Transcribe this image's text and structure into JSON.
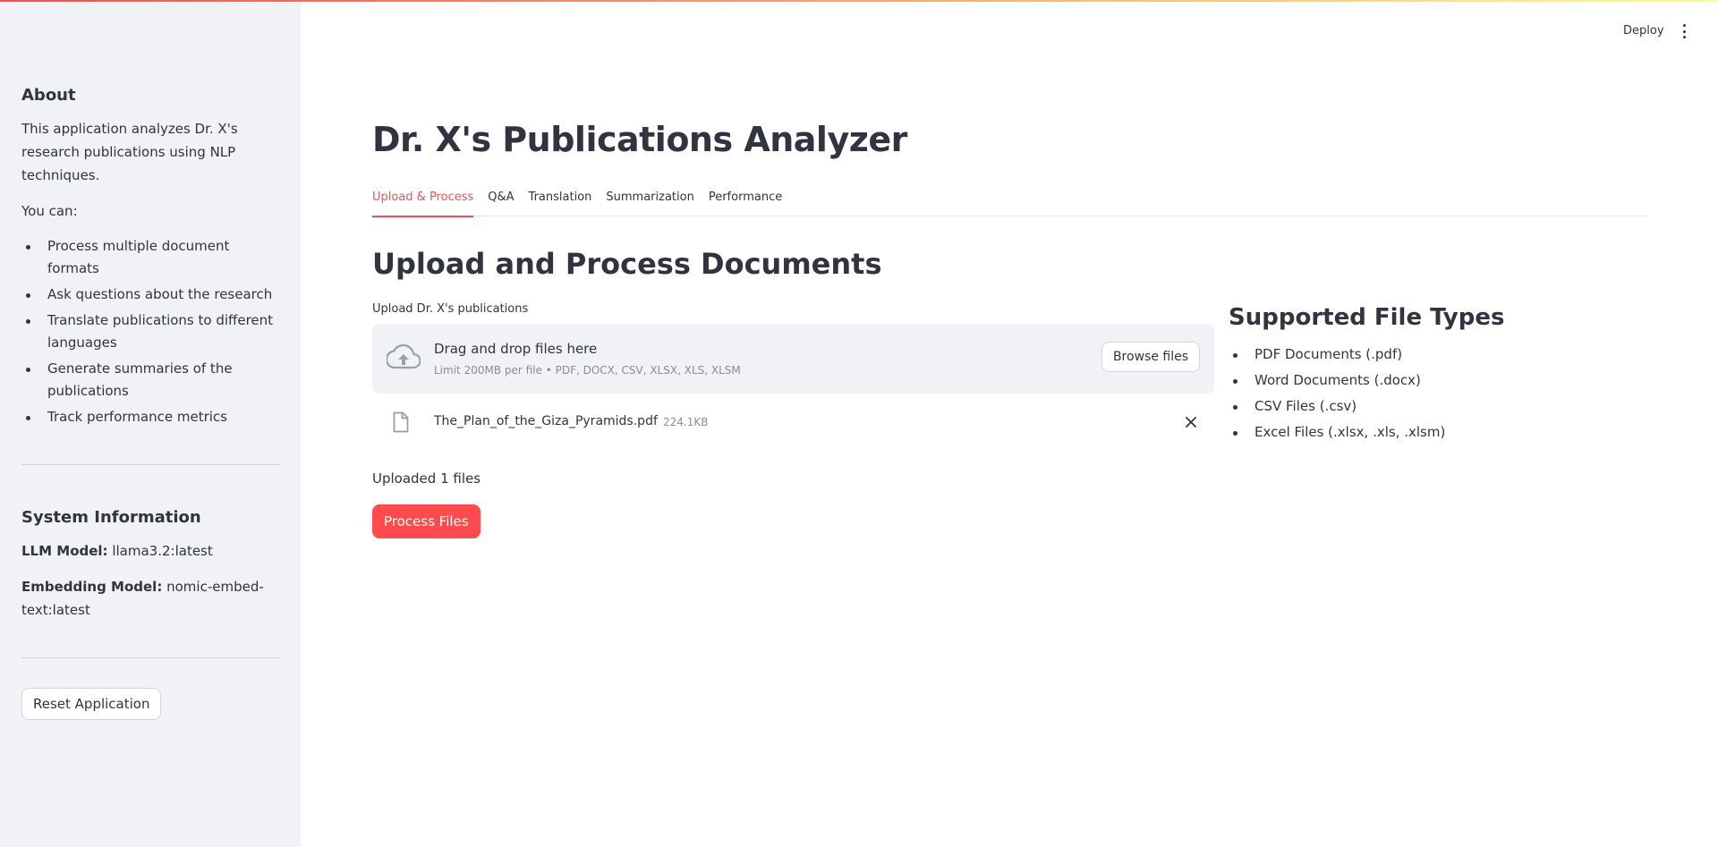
{
  "header": {
    "deploy_label": "Deploy"
  },
  "sidebar": {
    "about_heading": "About",
    "about_text": "This application analyzes Dr. X's research publications using NLP techniques.",
    "you_can": "You can:",
    "items": [
      "Process multiple document formats",
      "Ask questions about the research",
      "Translate publications to different languages",
      "Generate summaries of the publications",
      "Track performance metrics"
    ],
    "system_heading": "System Information",
    "llm_label": "LLM Model:",
    "llm_value": "llama3.2:latest",
    "embedding_label": "Embedding Model:",
    "embedding_value": "nomic-embed-text:latest",
    "reset_label": "Reset Application"
  },
  "main": {
    "title": "Dr. X's Publications Analyzer",
    "tabs": [
      {
        "label": "Upload & Process",
        "active": true
      },
      {
        "label": "Q&A",
        "active": false
      },
      {
        "label": "Translation",
        "active": false
      },
      {
        "label": "Summarization",
        "active": false
      },
      {
        "label": "Performance",
        "active": false
      }
    ],
    "section_title": "Upload and Process Documents",
    "upload_label": "Upload Dr. X's publications",
    "dropzone": {
      "title": "Drag and drop files here",
      "limit": "Limit 200MB per file • PDF, DOCX, CSV, XLSX, XLS, XLSM",
      "browse_label": "Browse files"
    },
    "file": {
      "name": "The_Plan_of_the_Giza_Pyramids.pdf",
      "size": "224.1KB"
    },
    "uploaded_text": "Uploaded 1 files",
    "process_label": "Process Files"
  },
  "types": {
    "heading": "Supported File Types",
    "items": [
      "PDF Documents (.pdf)",
      "Word Documents (.docx)",
      "CSV Files (.csv)",
      "Excel Files (.xlsx, .xls, .xlsm)"
    ]
  },
  "colors": {
    "accent": "#ff4b4b",
    "sidebar_bg": "#f0f2f6",
    "text": "#31333f"
  }
}
